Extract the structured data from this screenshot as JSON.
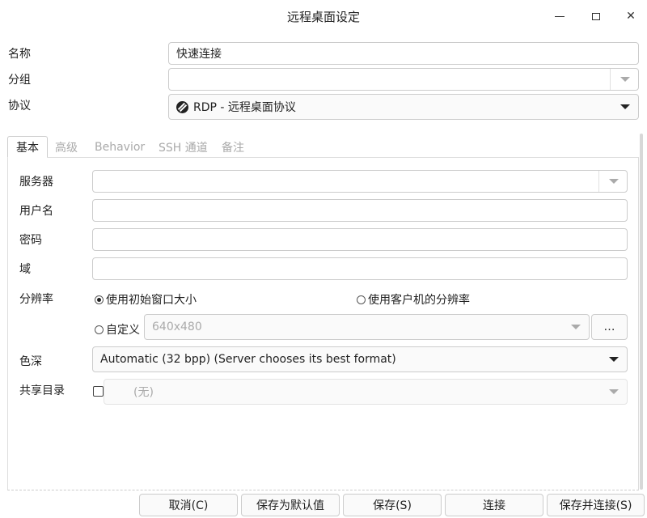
{
  "window": {
    "title": "远程桌面设定"
  },
  "form": {
    "name_label": "名称",
    "name_value": "快速连接",
    "group_label": "分组",
    "group_value": "",
    "protocol_label": "协议",
    "protocol_value": "RDP - 远程桌面协议"
  },
  "tabs": [
    {
      "label": "基本"
    },
    {
      "label": "高级"
    },
    {
      "label": "Behavior"
    },
    {
      "label": "SSH 通道"
    },
    {
      "label": "备注"
    }
  ],
  "basic": {
    "server_label": "服务器",
    "username_label": "用户名",
    "password_label": "密码",
    "domain_label": "域",
    "resolution_label": "分辨率",
    "res_initial": "使用初始窗口大小",
    "res_client": "使用客户机的分辨率",
    "res_custom": "自定义",
    "res_custom_value": "640x480",
    "browse_label": "…",
    "color_label": "色深",
    "color_value": "Automatic (32 bpp) (Server chooses its best format)",
    "share_label": "共享目录",
    "share_value": "(无)"
  },
  "buttons": {
    "cancel": "取消(C)",
    "save_default": "保存为默认值",
    "save": "保存(S)",
    "connect": "连接",
    "save_connect": "保存并连接(S)"
  }
}
